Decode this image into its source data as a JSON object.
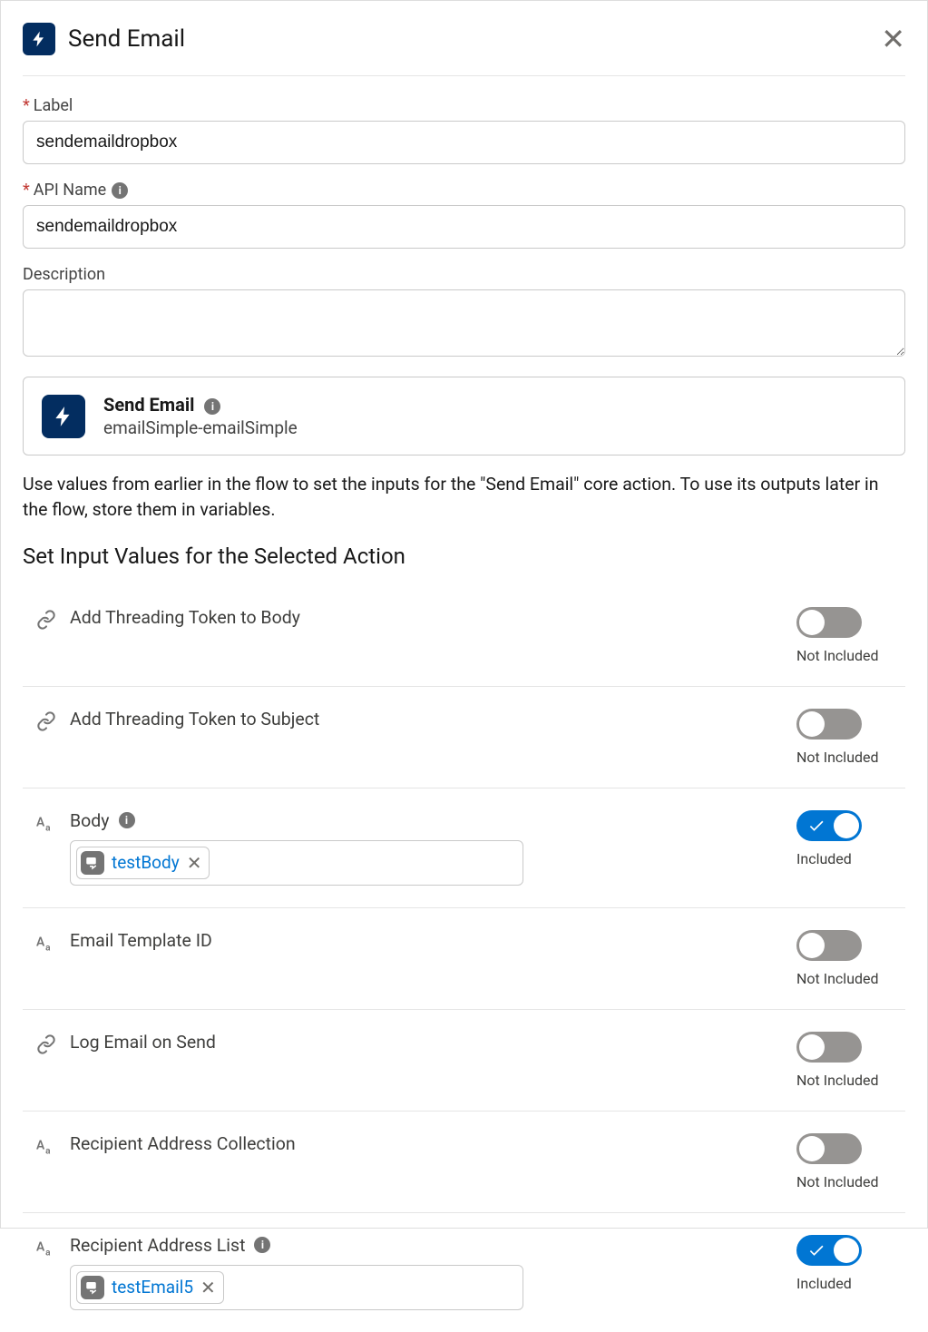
{
  "header": {
    "title": "Send Email"
  },
  "labels": {
    "label_field": "Label",
    "api_name_field": "API Name",
    "description_field": "Description"
  },
  "form": {
    "label_value": "sendemaildropbox",
    "api_name_value": "sendemaildropbox",
    "description_value": ""
  },
  "action_card": {
    "title": "Send Email",
    "sub": "emailSimple-emailSimple"
  },
  "help_text": "Use values from earlier in the flow to set the inputs for the \"Send Email\" core action. To use its outputs later in the flow, store them in variables.",
  "section_title": "Set Input Values for the Selected Action",
  "toggle_labels": {
    "included": "Included",
    "not_included": "Not Included"
  },
  "params": [
    {
      "type": "link",
      "label": "Add Threading Token to Body",
      "info": false,
      "included": false
    },
    {
      "type": "link",
      "label": "Add Threading Token to Subject",
      "info": false,
      "included": false
    },
    {
      "type": "text",
      "label": "Body",
      "info": true,
      "included": true,
      "pill": "testBody"
    },
    {
      "type": "text",
      "label": "Email Template ID",
      "info": false,
      "included": false
    },
    {
      "type": "link",
      "label": "Log Email on Send",
      "info": false,
      "included": false
    },
    {
      "type": "text",
      "label": "Recipient Address Collection",
      "info": false,
      "included": false
    },
    {
      "type": "text",
      "label": "Recipient Address List",
      "info": true,
      "included": true,
      "pill": "testEmail5"
    }
  ]
}
